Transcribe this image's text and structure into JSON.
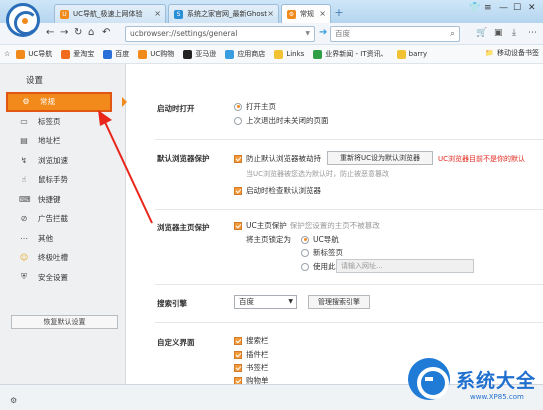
{
  "tabs": [
    {
      "label": "UC导航_极速上网体验",
      "icon_color": "#f28a1b",
      "icon_glyph": "U"
    },
    {
      "label": "系统之家官网_最新Ghost",
      "icon_color": "#2b8fd8",
      "icon_glyph": "S"
    },
    {
      "label": "常规",
      "icon_color": "#f28a1b",
      "icon_glyph": "⚙"
    }
  ],
  "address": {
    "url": "ucbrowser://settings/general",
    "search_placeholder": "百度"
  },
  "bookmarks": [
    {
      "label": "UC导航",
      "icon_color": "#f28a1b",
      "icon": "uc-icon"
    },
    {
      "label": "爱淘宝",
      "icon_color": "#f26a1b",
      "icon": "taobao-icon"
    },
    {
      "label": "百度",
      "icon_color": "#2b6fd8",
      "icon": "baidu-icon"
    },
    {
      "label": "UC购物",
      "icon_color": "#f28a1b",
      "icon": "uc-shop-icon"
    },
    {
      "label": "亚马逊",
      "icon_color": "#222222",
      "icon": "amazon-icon"
    },
    {
      "label": "应用商店",
      "icon_color": "#3a9de0",
      "icon": "appstore-icon"
    },
    {
      "label": "Links",
      "icon_color": "#f1c232",
      "icon": "folder-icon"
    },
    {
      "label": "业界新闻 - IT资讯、",
      "icon_color": "#2f9e44",
      "icon": "news-icon"
    },
    {
      "label": "barry",
      "icon_color": "#f1c232",
      "icon": "folder-icon"
    }
  ],
  "bookmark_right": "移动设备书签",
  "settings_title": "设置",
  "nav": [
    {
      "label": "常规",
      "icon": "gear-icon",
      "glyph": "⚙"
    },
    {
      "label": "标签页",
      "icon": "tab-icon",
      "glyph": "▭"
    },
    {
      "label": "地址栏",
      "icon": "address-bar-icon",
      "glyph": "▤"
    },
    {
      "label": "浏览加速",
      "icon": "speed-icon",
      "glyph": "↯"
    },
    {
      "label": "鼠标手势",
      "icon": "mouse-gesture-icon",
      "glyph": "☝"
    },
    {
      "label": "快捷键",
      "icon": "keyboard-icon",
      "glyph": "⌨"
    },
    {
      "label": "广告拦截",
      "icon": "ad-block-icon",
      "glyph": "⊘"
    },
    {
      "label": "其他",
      "icon": "more-icon",
      "glyph": "⋯"
    },
    {
      "label": "终极吐槽",
      "icon": "feedback-icon",
      "glyph": "☺"
    },
    {
      "label": "安全设置",
      "icon": "shield-icon",
      "glyph": "⛨"
    }
  ],
  "restore_button": "恢复默认设置",
  "startup": {
    "label": "启动时打开",
    "options": [
      "打开主页",
      "上次退出时未关闭的页面"
    ],
    "selected": 0
  },
  "default_browser": {
    "label": "默认浏览器保护",
    "protect_label": "防止默认浏览器被劫持",
    "set_default_button": "重新将UC设为默认浏览器",
    "warning": "UC浏览器目前不是你的默认",
    "hint": "当UC浏览器被您选为默认时，防止被恶意篡改",
    "check_on_start": "启动时检查默认浏览器"
  },
  "homepage_protect": {
    "label": "浏览器主页保护",
    "protect_label": "UC主页保护",
    "protect_hint": "保护您设置的主页不被篡改",
    "lock_label": "将主页锁定为",
    "options": [
      "UC导航",
      "新标签页",
      "使用此页"
    ],
    "selected": 0,
    "url_placeholder": "请输入网址..."
  },
  "search_engine": {
    "label": "搜索引擎",
    "selected": "百度",
    "manage_button": "管理搜索引擎"
  },
  "custom_ui": {
    "label": "自定义界面",
    "items": [
      "搜索栏",
      "插件栏",
      "书签栏",
      "购物单"
    ]
  },
  "watermark": {
    "text": "系统大全",
    "url": "www.XP85.com"
  },
  "colors": {
    "accent": "#f28a1b",
    "active_border": "#e25614",
    "warning": "#e0261b"
  }
}
